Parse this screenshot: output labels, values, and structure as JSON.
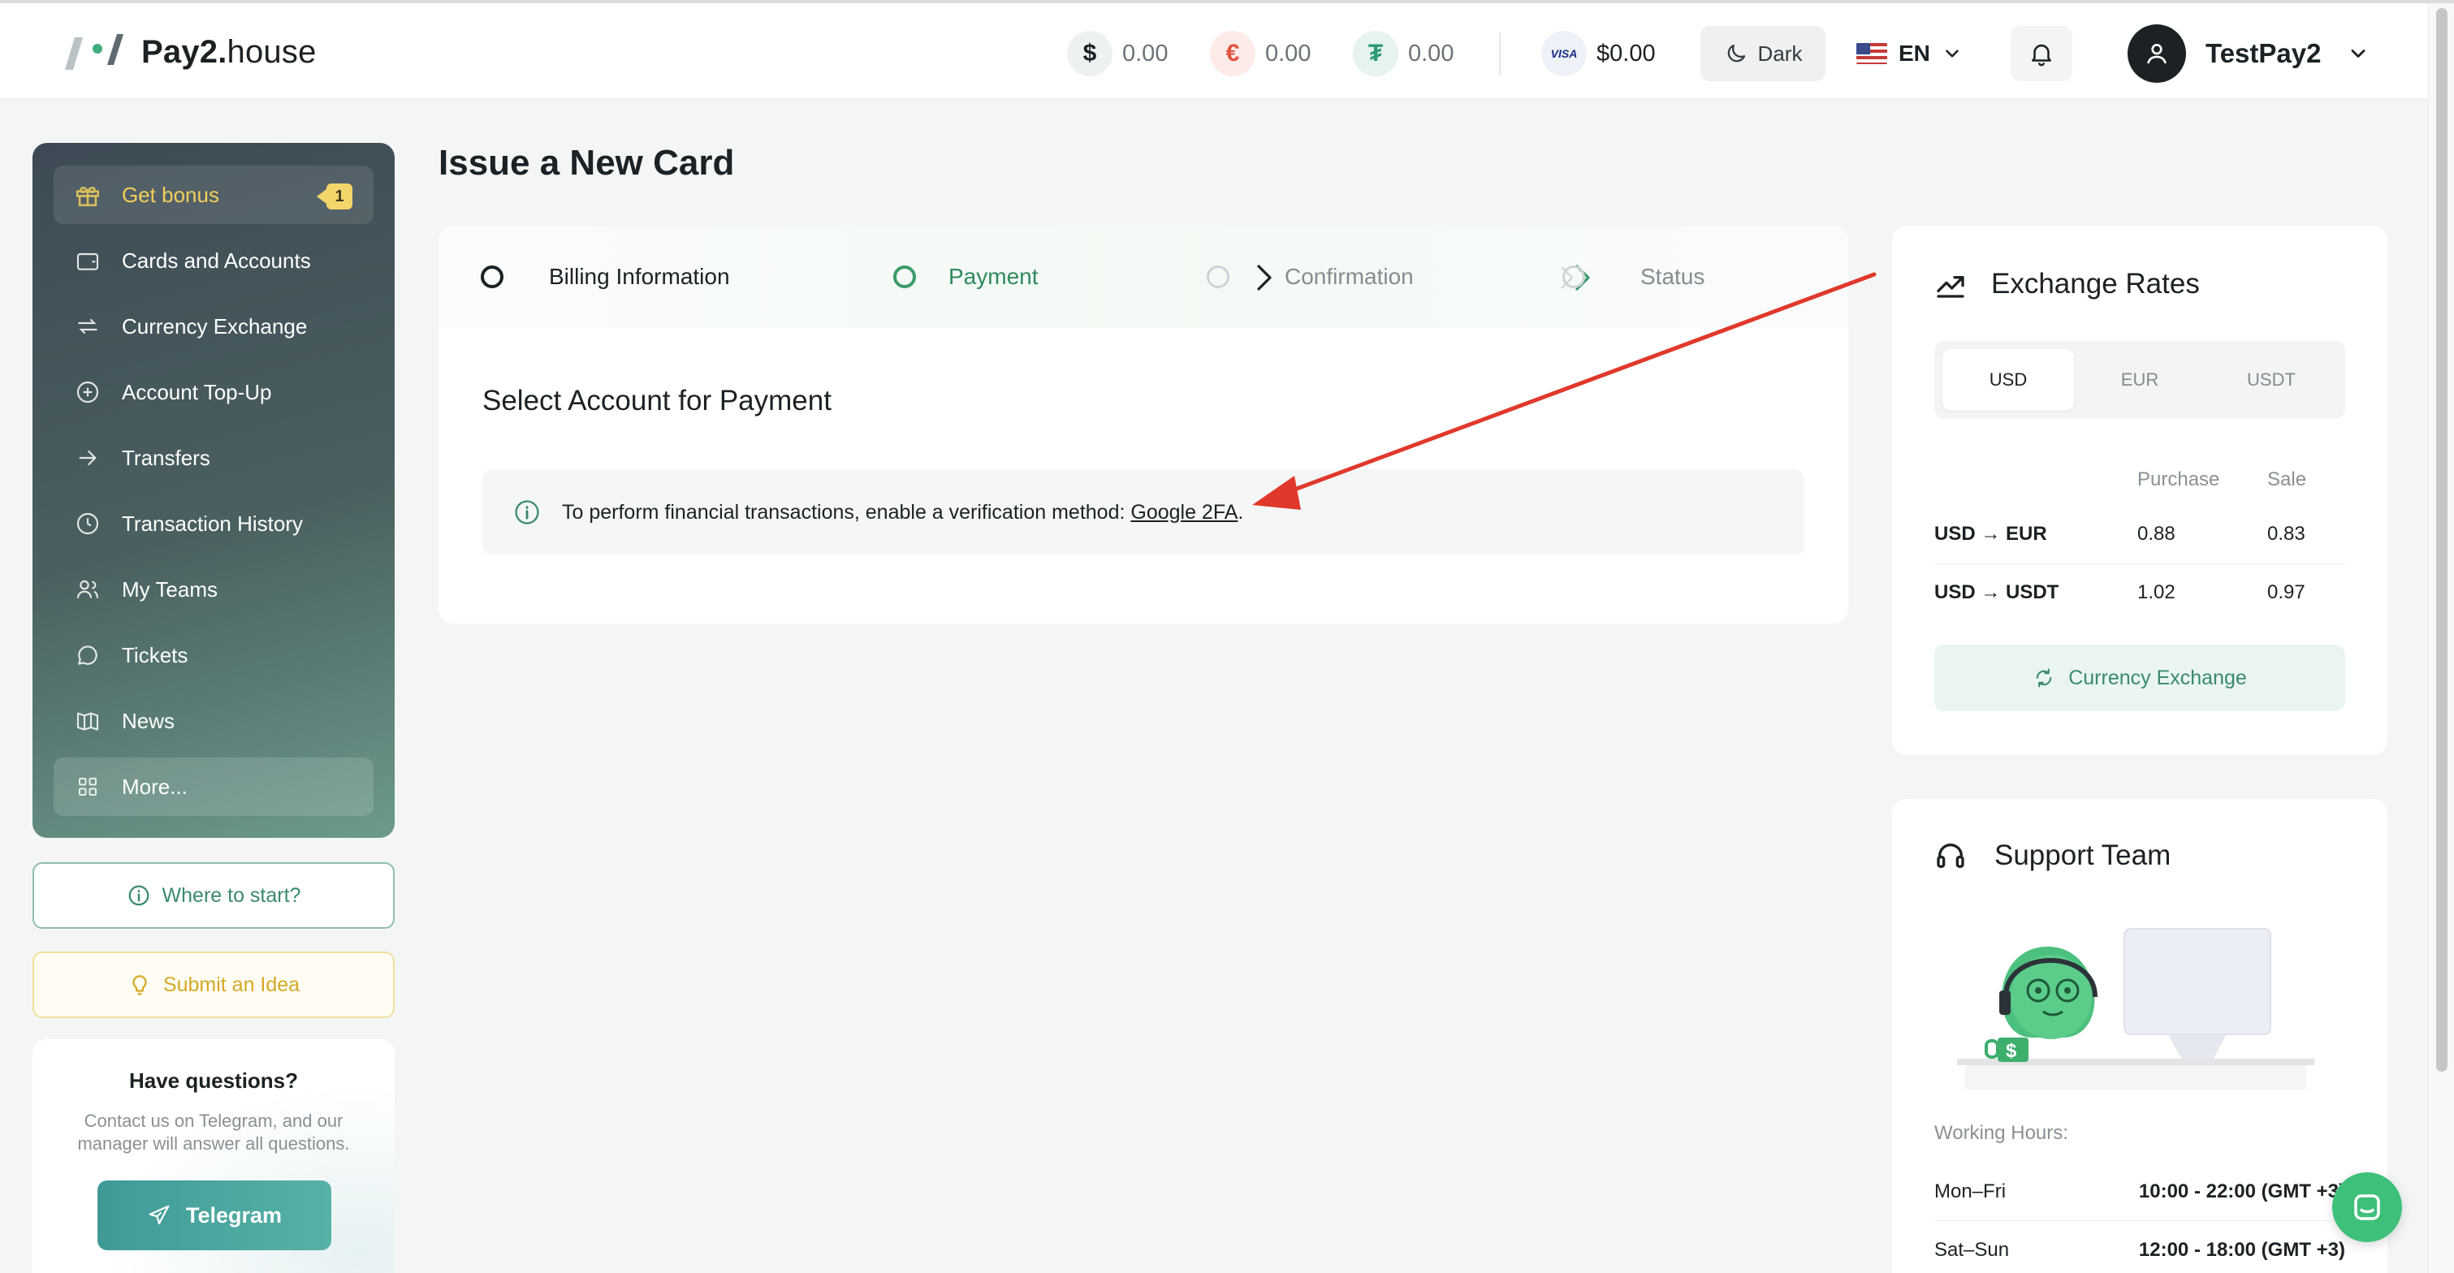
{
  "header": {
    "logo_text_bold": "Pay2.",
    "logo_text_rest": "house",
    "balances": [
      {
        "currency": "usd",
        "symbol": "$",
        "value": "0.00"
      },
      {
        "currency": "eur",
        "symbol": "€",
        "value": "0.00"
      },
      {
        "currency": "usdt",
        "symbol": "₮",
        "value": "0.00"
      },
      {
        "currency": "visa",
        "symbol": "VISA",
        "value": "$0.00"
      }
    ],
    "theme_label": "Dark",
    "language": "EN",
    "username": "TestPay2"
  },
  "sidebar": {
    "items": [
      {
        "label": "Get bonus",
        "icon": "gift-icon",
        "badge": "1"
      },
      {
        "label": "Cards and Accounts",
        "icon": "wallet-icon"
      },
      {
        "label": "Currency Exchange",
        "icon": "exchange-icon"
      },
      {
        "label": "Account Top-Up",
        "icon": "plus-circle-icon"
      },
      {
        "label": "Transfers",
        "icon": "arrow-right-icon"
      },
      {
        "label": "Transaction History",
        "icon": "clock-icon"
      },
      {
        "label": "My Teams",
        "icon": "users-icon"
      },
      {
        "label": "Tickets",
        "icon": "chat-icon"
      },
      {
        "label": "News",
        "icon": "book-icon"
      },
      {
        "label": "More...",
        "icon": "grid-icon"
      }
    ],
    "where_to_start": "Where to start?",
    "submit_idea": "Submit an Idea",
    "help": {
      "title": "Have questions?",
      "text": "Contact us on Telegram, and our manager will answer all questions.",
      "telegram_label": "Telegram"
    }
  },
  "main": {
    "page_title": "Issue a New Card",
    "steps": [
      "Billing Information",
      "Payment",
      "Confirmation",
      "Status"
    ],
    "section_title": "Select Account for Payment",
    "info_text": "To perform financial transactions, enable a verification method: ",
    "info_link": "Google 2FA",
    "info_end": "."
  },
  "rates": {
    "title": "Exchange Rates",
    "tabs": [
      "USD",
      "EUR",
      "USDT"
    ],
    "active_tab": "USD",
    "columns": [
      "Purchase",
      "Sale"
    ],
    "rows": [
      {
        "pair": "USD → EUR",
        "purchase": "0.88",
        "sale": "0.83"
      },
      {
        "pair": "USD → USDT",
        "purchase": "1.02",
        "sale": "0.97"
      }
    ],
    "button_label": "Currency Exchange"
  },
  "support": {
    "title": "Support Team",
    "hours_label": "Working Hours:",
    "hours": [
      {
        "days": "Mon–Fri",
        "time": "10:00 - 22:00 (GMT +3)"
      },
      {
        "days": "Sat–Sun",
        "time": "12:00 - 18:00 (GMT +3)"
      }
    ]
  },
  "colors": {
    "accent_green": "#3b8a6e",
    "annotation_red": "#e0392b",
    "sidebar_dark": "#3d4a55"
  }
}
